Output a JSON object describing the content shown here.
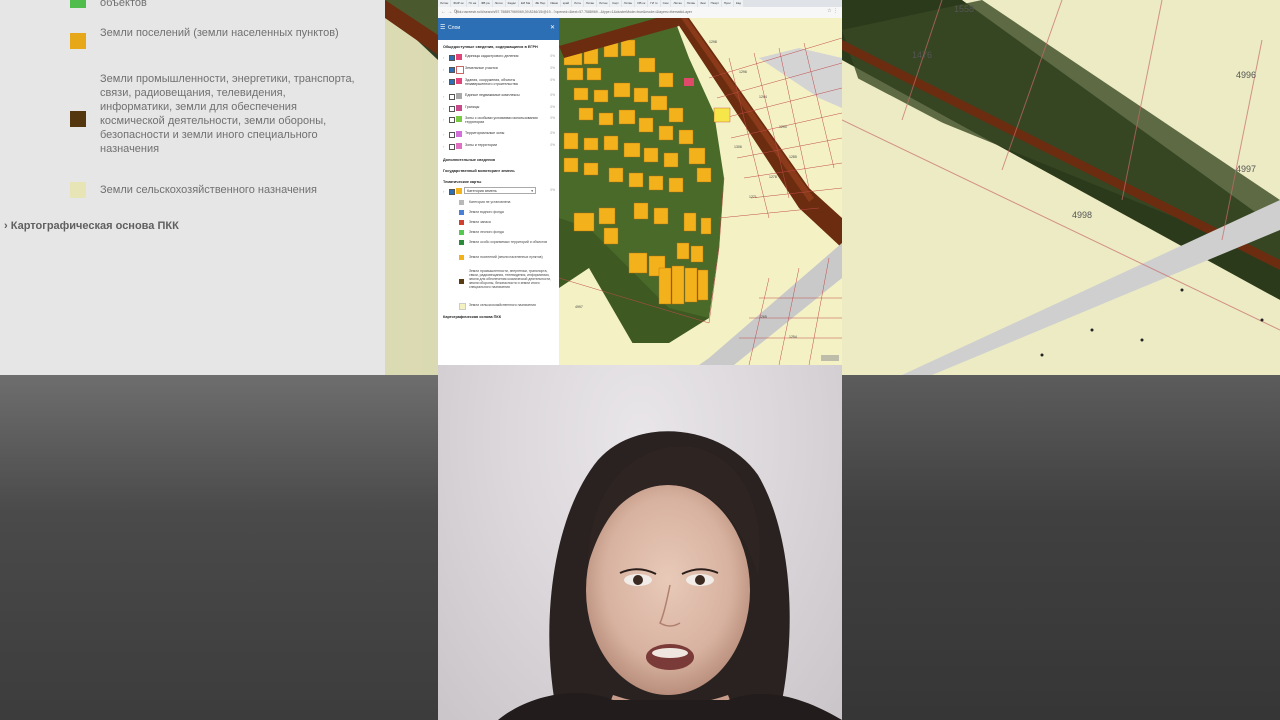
{
  "browser": {
    "tabs": [
      "Литан",
      "ФНР ок",
      "ГК на",
      "ФВ ра",
      "Логин",
      "Кадас",
      "ЕИ Ма",
      "ЗЕ Пер",
      "Ивам",
      "край",
      "Лита",
      "Литан",
      "Литан",
      "Карт",
      "Литан",
      "ОВ ок",
      "ГИ тк",
      "Сем",
      "Литан",
      "Литан",
      "Зем",
      "Пкарт",
      "Прос",
      "Кад"
    ],
    "url": "pkk.rosreestr.ru/#/search/57.758897969069,39.8246/15/@19...?opened=&text=57.7588969...&type=1&clusterMode=true&mode=&layers=thematicLayer"
  },
  "panel": {
    "title": "Слои",
    "section_egrn": "Общедоступные сведения, содержащиеся в ЕГРН",
    "layers": [
      {
        "label": "Единицы кадастрового деления",
        "checked": true,
        "color": "#e0447a",
        "pct": "0%"
      },
      {
        "label": "Земельные участки",
        "checked": true,
        "color": "#ffffff",
        "pct": "0%"
      },
      {
        "label": "Здания, сооружения, объекты незавершенного строительства",
        "checked": true,
        "color": "#e0447a",
        "pct": "0%"
      },
      {
        "label": "Единые недвижимые комплексы",
        "checked": false,
        "color": "#a8a8a8",
        "pct": "0%"
      },
      {
        "label": "Границы",
        "checked": false,
        "color": "#c84a8a",
        "pct": "0%"
      },
      {
        "label": "Зоны с особыми условиями использования территории",
        "checked": false,
        "color": "#7ac943",
        "pct": "0%"
      },
      {
        "label": "Территориальные зоны",
        "checked": false,
        "color": "#d070d8",
        "pct": "0%"
      },
      {
        "label": "Зоны и территории",
        "checked": false,
        "color": "#e070c0",
        "pct": "0%"
      }
    ],
    "section_extra": "Дополнительные сведения",
    "section_monitor": "Государственный мониторинг земель",
    "section_thematic": "Тематические карты",
    "thematic_select": "Категория земель",
    "thematic_pct": "0%",
    "legend": [
      {
        "label": "Категория не установлена",
        "color": "#b8b8b8"
      },
      {
        "label": "Земли водного фонда",
        "color": "#4a7fd8"
      },
      {
        "label": "Земли запаса",
        "color": "#d04030"
      },
      {
        "label": "Земли лесного фонда",
        "color": "#54c850"
      },
      {
        "label": "Земли особо охраняемых территорий и объектов",
        "color": "#2a8a3a"
      },
      {
        "label": "Земли поселений (земли населенных пунктов)",
        "color": "#f3b21b"
      },
      {
        "label": "Земли промышленности, энергетики, транспорта, связи, радиовещания, телевидения, информатики, земли для обеспечения космической деятельности, земли обороны, безопасности и земли иного специального назначения",
        "color": "#5a3a10"
      },
      {
        "label": "Земли сельскохозяйственного назначения",
        "color": "#f4f2c0"
      }
    ],
    "section_base": "Картографическая основа ПКК"
  },
  "background": {
    "legend_top": "объектов",
    "legend_settlement": "Земли поселений (земли населенных пунктов)",
    "legend_industry": "Земли промышленности, энергетики, транспорта, связи, радиовещания, телевидения, информатики, земли для обеспечения космической деятельности, земли обороны, безопасности и земли иного специального назначения",
    "legend_agri": "Земли сельскохозяйственного назначения",
    "section_base": "Картографическая основа ПКК",
    "map_labels": [
      "1558",
      "1476",
      "4996",
      "4997",
      "4998"
    ]
  },
  "map": {
    "labels": [
      "1298",
      "1296",
      "1294",
      "1290",
      "1285",
      "1306",
      "1278",
      "1271",
      "1265",
      "1254",
      "4997"
    ]
  },
  "colors": {
    "settlement": "#f3b21b",
    "industry": "#5a3a10",
    "agri": "#f4f2c0",
    "panel_header": "#2d6fb5"
  }
}
